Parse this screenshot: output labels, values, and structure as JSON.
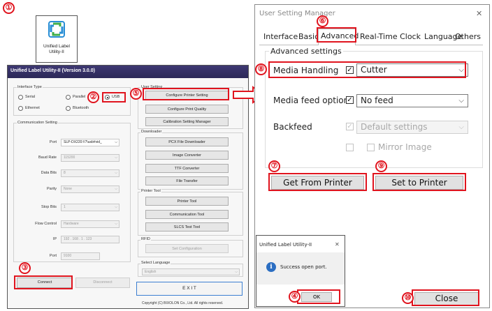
{
  "markers": [
    "①",
    "②",
    "③",
    "④",
    "⑤",
    "⑥",
    "⑦",
    "⑧",
    "⑨",
    "⑩"
  ],
  "app_icon": {
    "label": "Unified Label Utility-II"
  },
  "utility": {
    "title": "Unified Label Utility-II (Version 3.0.0)",
    "interface_type": {
      "title": "Interface Type",
      "options": [
        "Serial",
        "Parallel",
        "USB",
        "Ethernet",
        "Bluetooth"
      ],
      "selected": "USB"
    },
    "comm": {
      "title": "Communication Setting",
      "port_label": "Port",
      "port_value": "SLP-DX220:\\\\?\\usb#vid_",
      "baud_label": "Baud Rate",
      "baud_value": "115200",
      "databits_label": "Data Bits",
      "databits_value": "8",
      "parity_label": "Parity",
      "parity_value": "None",
      "stopbits_label": "Stop Bits",
      "stopbits_value": "1",
      "flow_label": "Flow Control",
      "flow_value": "Hardware",
      "ip_label": "IP",
      "ip_value": "192  .  168  .   1   .  123",
      "tcpport_label": "Port",
      "tcpport_value": "9100"
    },
    "connect": "Connect",
    "disconnect": "Disconnect",
    "user_setting": {
      "title": "User Setting",
      "buttons": [
        "Configure Printer Setting",
        "Configure Print Quality",
        "Calibration Setting Manager"
      ]
    },
    "downloader": {
      "title": "Downloader",
      "buttons": [
        "PCX File Downloader",
        "Image Converter",
        "TTF Converter",
        "File Transfer"
      ]
    },
    "printer_tool": {
      "title": "Printer Tool",
      "buttons": [
        "Printer Tool",
        "Communication Tool",
        "SLCS Test Tool"
      ]
    },
    "rfid": {
      "title": "RFID",
      "button": "Set Configuration"
    },
    "language": {
      "title": "Select Language",
      "value": "English"
    },
    "exit": "E X I T",
    "copyright": "Copyright (C) BIXOLON Co., Ltd. All rights reserved."
  },
  "manager": {
    "title": "User Setting Manager",
    "close_glyph": "✕",
    "tabs": [
      "Interface",
      "Basic",
      "Advanced",
      "Real-Time Clock",
      "Language",
      "Others"
    ],
    "active_tab": "Advanced",
    "section_title": "Advanced settings",
    "media_handling": {
      "label": "Media Handling",
      "value": "Cutter",
      "checked": true
    },
    "media_feed": {
      "label": "Media feed options",
      "value": "No feed",
      "checked": true
    },
    "backfeed": {
      "label": "Backfeed",
      "value": "Default settings",
      "checked": true
    },
    "mirror": {
      "label": "Mirror Image",
      "checked": false
    },
    "get_button": "Get From Printer",
    "set_button": "Set to Printer",
    "close_button": "Close"
  },
  "success_dialog": {
    "title": "Unified Label Utility-II",
    "close_glyph": "✕",
    "message": "Success open port.",
    "ok": "OK"
  }
}
